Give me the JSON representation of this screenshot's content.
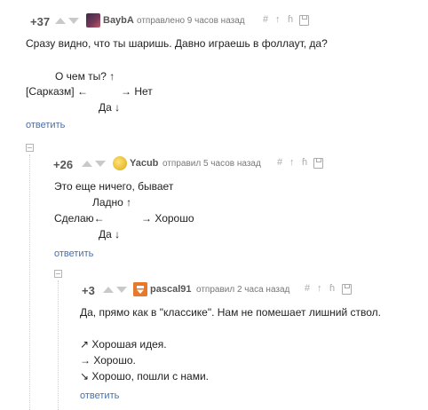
{
  "comments": [
    {
      "rating": "+37",
      "author": "BaybA",
      "timestamp": "отправлено 9 часов назад",
      "tools": [
        "#",
        "↑",
        "ɦ"
      ],
      "avatar_color": "#7a3a5a",
      "lines": [
        "Сразу видно, что ты шаришь. Давно играешь в фоллаут, да?",
        "О чем ты? ↑",
        "[Сарказм] ←",
        "→ Нет",
        "Да ↓"
      ],
      "reply_label": "ответить"
    },
    {
      "rating": "+26",
      "author": "Yacub",
      "timestamp": "отправил 5 часов назад",
      "tools": [
        "#",
        "↑",
        "ɦ"
      ],
      "avatar_color": "#e8c23a",
      "lines": [
        "Это еще ничего, бывает",
        "Ладно ↑",
        "Сделаю←",
        "→ Хорошо",
        "Да ↓"
      ],
      "reply_label": "ответить"
    },
    {
      "rating": "+3",
      "author": "pascal91",
      "timestamp": "отправил 2 часа назад",
      "tools": [
        "#",
        "↑",
        "ɦ"
      ],
      "avatar_color": "#e8782a",
      "lines": [
        "Да, прямо как в \"классике\". Нам не помешает лишний ствол.",
        "↗ Хорошая идея.",
        "→ Хорошо.",
        "↘ Хорошо, пошли с нами."
      ],
      "reply_label": "ответить"
    }
  ]
}
